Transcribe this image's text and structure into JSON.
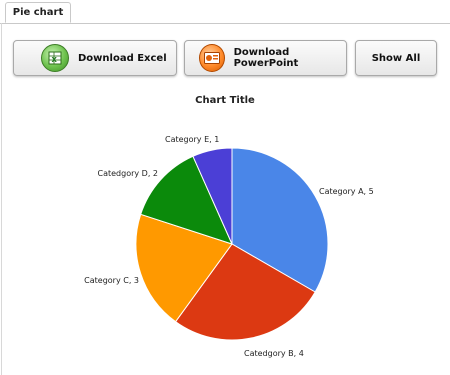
{
  "tab": {
    "label": "Pie chart"
  },
  "toolbar": {
    "excel_label": "Download Excel",
    "ppt_label": "Download PowerPoint",
    "showall_label": "Show All"
  },
  "chart_data": {
    "type": "pie",
    "title": "Chart Title",
    "categories": [
      "Category A",
      "Catedgory B",
      "Category C",
      "Catedgory D",
      "Category E"
    ],
    "values": [
      5,
      4,
      3,
      2,
      1
    ],
    "colors": [
      "#4a86e8",
      "#dc3912",
      "#ff9900",
      "#0b8a0b",
      "#4b3fd6"
    ],
    "labels": [
      "Category A, 5",
      "Catedgory B, 4",
      "Category C, 3",
      "Catedgory D, 2",
      "Category E, 1"
    ]
  }
}
